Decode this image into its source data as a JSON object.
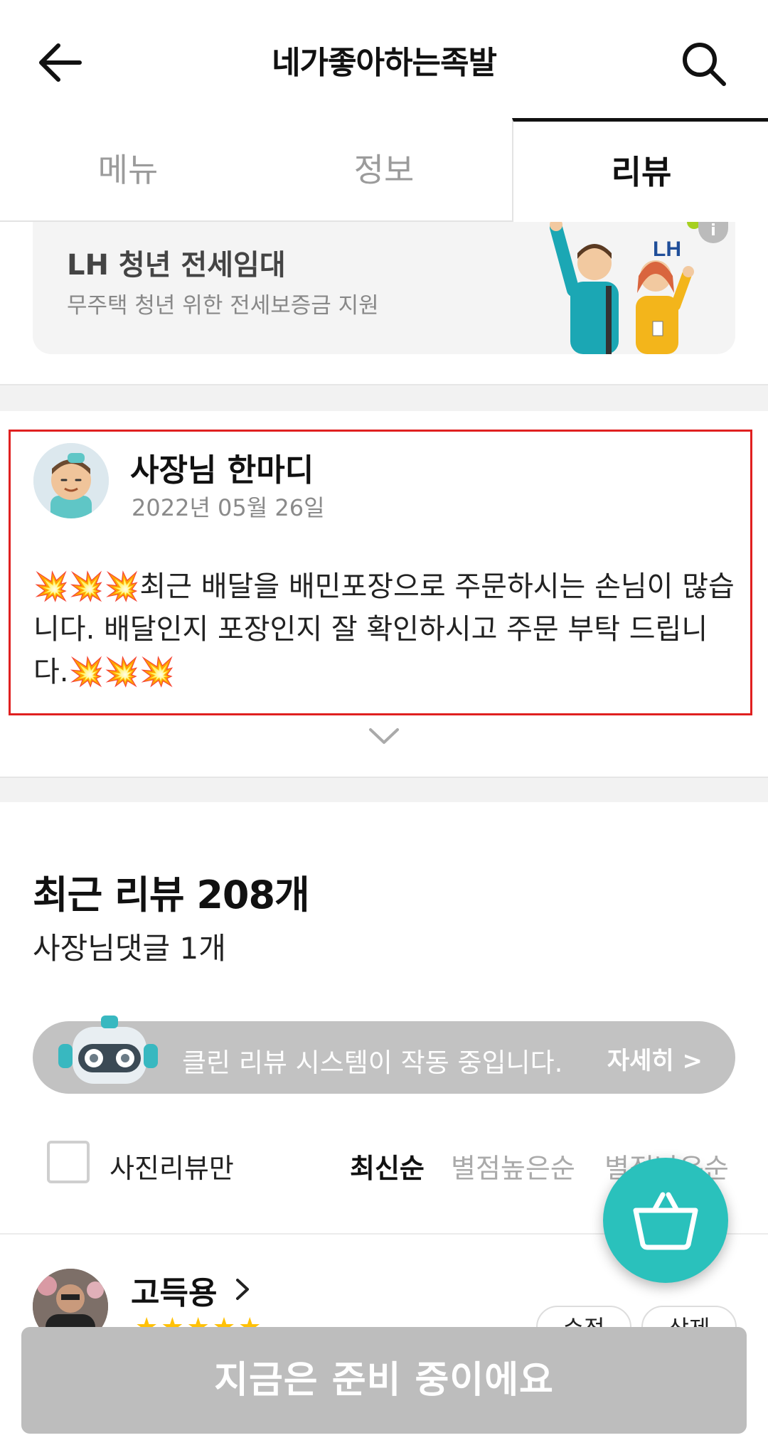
{
  "header": {
    "title": "네가좋아하는족발",
    "back_icon": "arrow-left-icon",
    "search_icon": "search-icon"
  },
  "tabs": [
    {
      "label": "메뉴",
      "selected": false
    },
    {
      "label": "정보",
      "selected": false
    },
    {
      "label": "리뷰",
      "selected": true
    }
  ],
  "ad": {
    "title": "LH 청년 전세임대",
    "subtitle": "무주택 청년 위한 전세보증금 지원",
    "brand": "LH"
  },
  "owner_note": {
    "name": "사장님 한마디",
    "date": "2022년 05월 26일",
    "message": "💥💥💥최근 배달을 배민포장으로 주문하시는 손님이 많습니다. 배달인지 포장인지 잘 확인하시고 주문 부탁 드립니다.💥💥💥"
  },
  "reviews_section": {
    "title": "최근 리뷰 208개",
    "owner_reply_count": "사장님댓글 1개",
    "clean_review_text": "클린 리뷰 시스템이 작동 중입니다.",
    "clean_review_detail": "자세히 >",
    "photo_only_label": "사진리뷰만",
    "photo_only_checked": false,
    "sort_options": [
      "최신순",
      "별점높은순",
      "별점낮은순"
    ],
    "sort_selected": "최신순"
  },
  "review": {
    "reviewer_name": "고득용",
    "rating": 5,
    "stars": "★★★★★",
    "edit_label": "수정",
    "delete_label": "삭제"
  },
  "cta": {
    "label": "지금은 준비 중이에요"
  },
  "colors": {
    "accent": "#2ac1bc",
    "highlight_border": "#e02020",
    "cta_disabled": "#bdbdbd"
  }
}
